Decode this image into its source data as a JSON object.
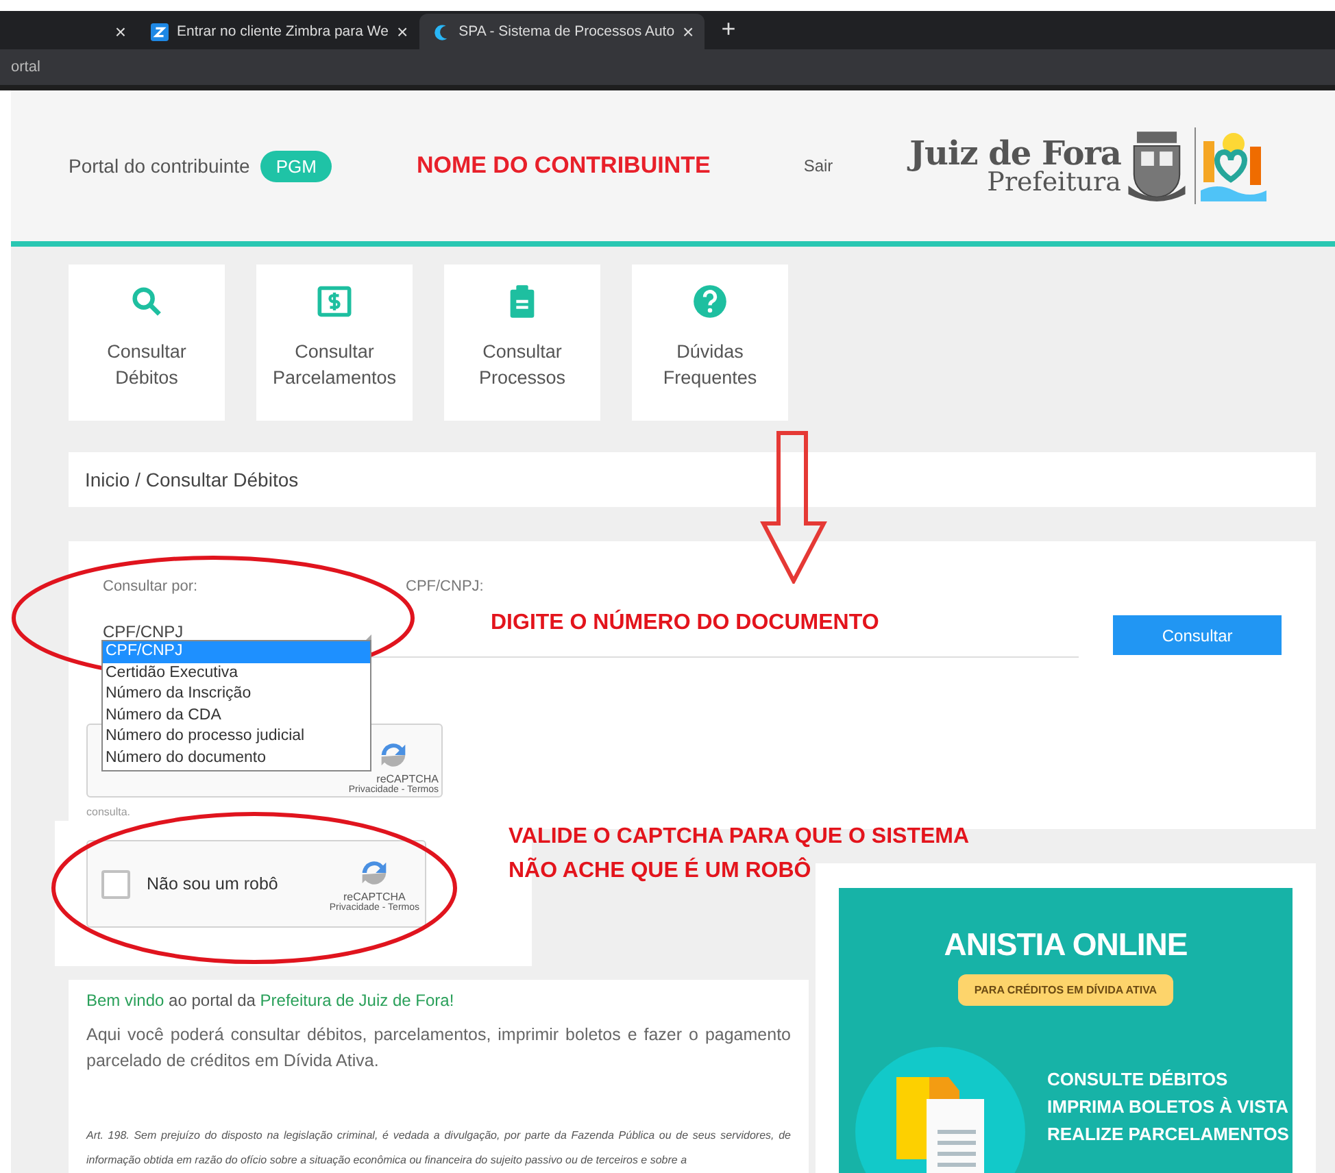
{
  "browser": {
    "tabs": [
      {
        "selected": false
      },
      {
        "title": "Entrar no cliente Zimbra para We",
        "selected": false
      },
      {
        "title": "SPA - Sistema de Processos Auto",
        "selected": true
      }
    ],
    "new_tab": "+",
    "close": "×",
    "address": "ortal"
  },
  "header": {
    "portal_label": "Portal do contribuinte",
    "badge": "PGM",
    "user_name": "NOME DO CONTRIBUINTE",
    "logout": "Sair",
    "logo_title": "Juiz de Fora",
    "logo_subtitle": "Prefeitura"
  },
  "menu_cards": [
    {
      "label": "Consultar Débitos"
    },
    {
      "label": "Consultar Parcelamentos"
    },
    {
      "label": "Consultar Processos"
    },
    {
      "label": "Dúvidas Frequentes"
    }
  ],
  "breadcrumb": "Inicio / Consultar Débitos",
  "form": {
    "consult_by_label": "Consultar por:",
    "consult_by_value": "CPF/CNPJ",
    "document_label": "CPF/CNPJ:",
    "submit": "Consultar",
    "options": [
      {
        "label": "CPF/CNPJ",
        "selected": true
      },
      {
        "label": "Certidão Executiva",
        "selected": false
      },
      {
        "label": "Número da Inscrição",
        "selected": false
      },
      {
        "label": "Número da CDA",
        "selected": false
      },
      {
        "label": "Número do processo judicial",
        "selected": false
      },
      {
        "label": "Número do documento",
        "selected": false
      }
    ],
    "captcha_brand": "reCAPTCHA",
    "captcha_links": "Privacidade - Termos",
    "note": "consulta."
  },
  "captcha": {
    "label": "Não sou um robô",
    "checked": false,
    "brand": "reCAPTCHA",
    "links": "Privacidade - Termos"
  },
  "welcome": {
    "heading": "**Bem vindo** ao portal da **Prefeitura de Juiz de Fora!**",
    "text": "Aqui você poderá consultar débitos, parcelamentos, imprimir boletos e fazer o pagamento parcelado de créditos em Dívida Ativa.",
    "legal": "Art. 198. Sem prejuízo do disposto na legislação criminal, é vedada a divulgação, por parte da Fazenda Pública ou de seus servidores, de informação obtida em razão do ofício sobre a situação econômica ou financeira do sujeito passivo ou de terceiros e sobre a"
  },
  "banner": {
    "title": "ANISTIA ONLINE",
    "tag": "PARA CRÉDITOS EM DÍVIDA ATIVA",
    "lines": [
      "CONSULTE DÉBITOS",
      "IMPRIMA BOLETOS À VISTA",
      "REALIZE PARCELAMENTOS"
    ]
  },
  "annotations": [
    {
      "kind": "arrow"
    },
    {
      "kind": "ellipse"
    },
    {
      "kind": "ellipse"
    },
    {
      "kind": "note",
      "text": "DIGITE O NÚMERO DO DOCUMENTO"
    },
    {
      "kind": "note",
      "text": "VALIDE O CAPTCHA PARA QUE O SISTEMA NÃO ACHE QUE É UM ROBÔ"
    }
  ]
}
